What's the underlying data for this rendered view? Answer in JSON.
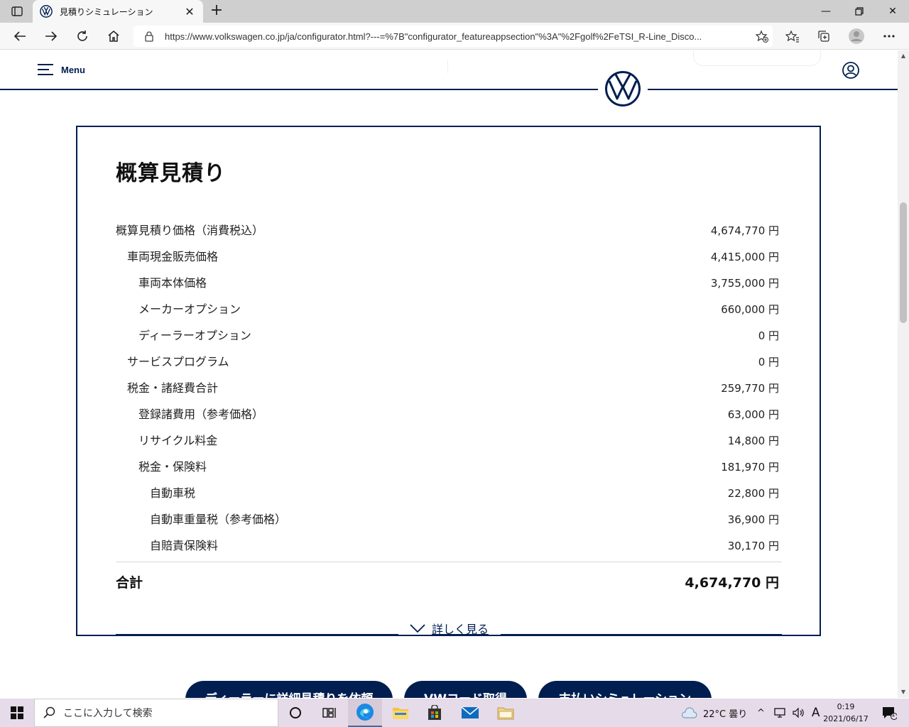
{
  "browser": {
    "tab_title": "見積りシミュレーション",
    "url": "https://www.volkswagen.co.jp/ja/configurator.html?---=%7B\"configurator_featureappsection\"%3A\"%2Fgolf%2FeTSI_R-Line_Disco..."
  },
  "header": {
    "menu_label": "Menu"
  },
  "estimate": {
    "title": "概算見積り",
    "rows": [
      {
        "label": "概算見積り価格（消費税込）",
        "value": "4,674,770 円"
      },
      {
        "label": "車両現金販売価格",
        "value": "4,415,000 円"
      },
      {
        "label": "車両本体価格",
        "value": "3,755,000 円"
      },
      {
        "label": "メーカーオプション",
        "value": "660,000 円"
      },
      {
        "label": "ディーラーオプション",
        "value": "0 円"
      },
      {
        "label": "サービスプログラム",
        "value": "0 円"
      },
      {
        "label": "税金・諸経費合計",
        "value": "259,770 円"
      },
      {
        "label": "登録諸費用（参考価格）",
        "value": "63,000 円"
      },
      {
        "label": "リサイクル料金",
        "value": "14,800 円"
      },
      {
        "label": "税金・保険料",
        "value": "181,970 円"
      },
      {
        "label": "自動車税",
        "value": "22,800 円"
      },
      {
        "label": "自動車重量税（参考価格）",
        "value": "36,900 円"
      },
      {
        "label": "自賠責保険料",
        "value": "30,170 円"
      }
    ],
    "total_label": "合計",
    "total_value": "4,674,770 円",
    "more_label": "詳しく見る"
  },
  "actions": {
    "dealer_quote": "ディーラーに詳細見積りを依頼",
    "vw_code": "VWコード取得",
    "payment_sim": "支払いシミュレーション"
  },
  "taskbar": {
    "search_placeholder": "ここに入力して検索",
    "weather": "22°C  曇り",
    "ime": "A",
    "time": "0:19",
    "date": "2021/06/17",
    "notification_count": "1"
  },
  "colors": {
    "vw_blue": "#001e50",
    "taskbar": "#e6dbe8"
  }
}
